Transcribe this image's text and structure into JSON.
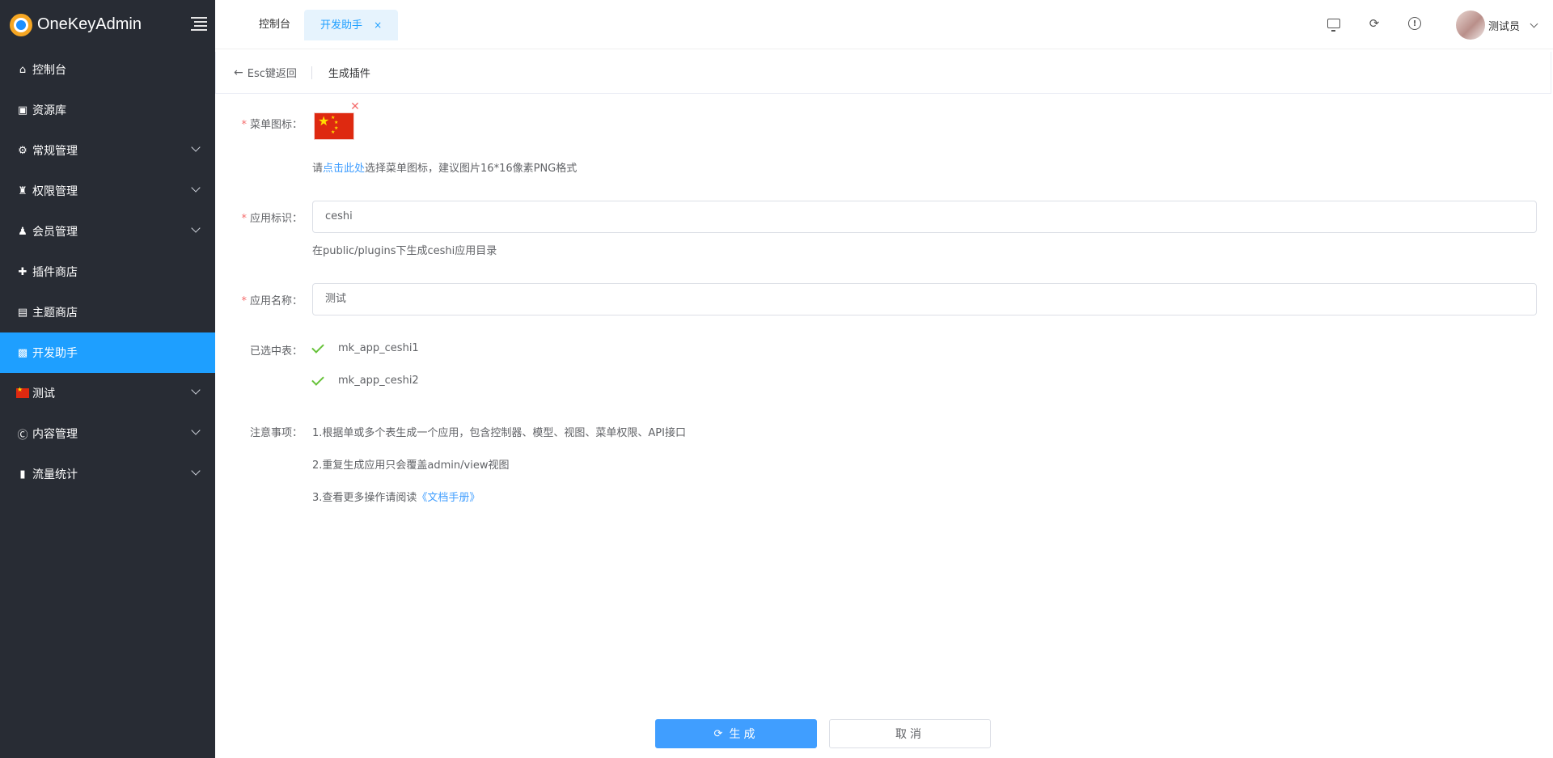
{
  "sidebar": {
    "brand": "OneKeyAdmin",
    "items": [
      {
        "label": "控制台",
        "icon": "home-icon",
        "arrow": false
      },
      {
        "label": "资源库",
        "icon": "wallet-icon",
        "arrow": false
      },
      {
        "label": "常规管理",
        "icon": "gear-icon",
        "arrow": true
      },
      {
        "label": "权限管理",
        "icon": "user-lock-icon",
        "arrow": true
      },
      {
        "label": "会员管理",
        "icon": "user-cog-icon",
        "arrow": true
      },
      {
        "label": "插件商店",
        "icon": "puzzle-icon",
        "arrow": false
      },
      {
        "label": "主题商店",
        "icon": "layout-icon",
        "arrow": false
      },
      {
        "label": "开发助手",
        "icon": "code-icon",
        "arrow": false,
        "active": true
      },
      {
        "label": "测试",
        "icon": "china-flag-icon",
        "arrow": true
      },
      {
        "label": "内容管理",
        "icon": "content-icon",
        "arrow": true
      },
      {
        "label": "流量统计",
        "icon": "bar-chart-icon",
        "arrow": true
      }
    ]
  },
  "header": {
    "tabs": [
      {
        "label": "控制台"
      },
      {
        "label": "开发助手",
        "active": true,
        "close": "×"
      }
    ],
    "user_name": "测试员"
  },
  "breadcrumb": {
    "back_label": "Esc键返回",
    "title": "生成插件"
  },
  "form": {
    "menu_icon": {
      "label": "菜单图标：",
      "hint_prefix": "请",
      "hint_link": "点击此处",
      "hint_suffix": "选择菜单图标，建议图片16*16像素PNG格式"
    },
    "app_id": {
      "label": "应用标识：",
      "value": "ceshi",
      "hint": "在public/plugins下生成ceshi应用目录"
    },
    "app_name": {
      "label": "应用名称：",
      "value": "测试"
    },
    "tables": {
      "label": "已选中表：",
      "items": [
        "mk_app_ceshi1",
        "mk_app_ceshi2"
      ]
    },
    "notes": {
      "label": "注意事项：",
      "line1": "1.根据单或多个表生成一个应用，包含控制器、模型、视图、菜单权限、API接口",
      "line2": "2.重复生成应用只会覆盖admin/view视图",
      "line3_prefix": "3.查看更多操作请阅读",
      "line3_link": "《文档手册》"
    }
  },
  "actions": {
    "generate": "生成",
    "cancel": "取消"
  },
  "colors": {
    "sidebar_bg": "#282c34",
    "active_blue": "#1e9fff",
    "primary": "#409eff",
    "required": "#f56c6c",
    "check": "#67c23a"
  }
}
